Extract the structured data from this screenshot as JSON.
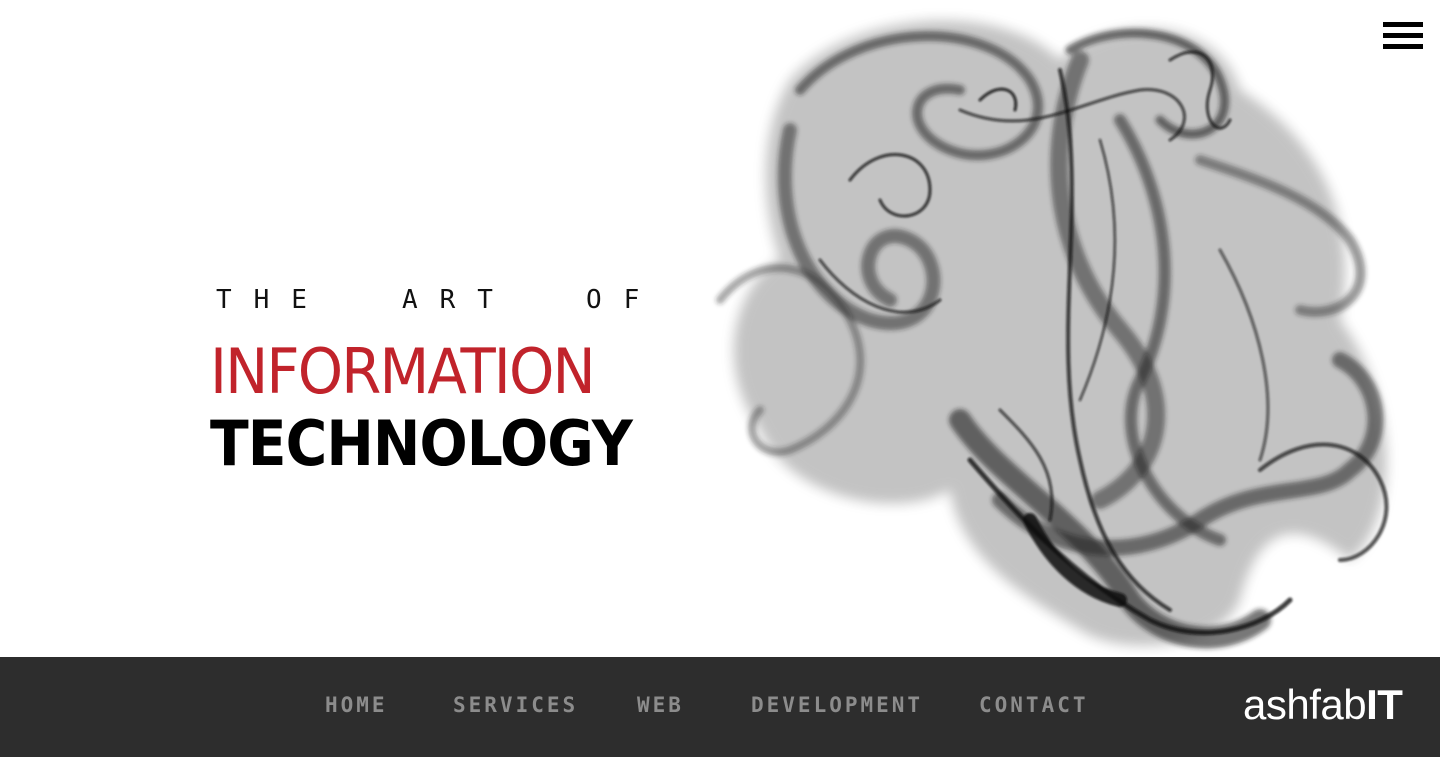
{
  "menu": {
    "icon": "hamburger-menu-icon"
  },
  "hero": {
    "tagline_words": [
      "THE",
      "ART",
      "OF"
    ],
    "headline_line1": "INFORMATION",
    "headline_line2": "TECHNOLOGY",
    "accent_color": "#c1232b"
  },
  "nav": {
    "items": [
      {
        "label": "HOME"
      },
      {
        "label": "SERVICES"
      },
      {
        "label": "WEB"
      },
      {
        "label": "DEVELOPMENT"
      },
      {
        "label": "CONTACT"
      }
    ],
    "background": "#2d2d2d",
    "text_color": "#8c8c8c"
  },
  "logo": {
    "light_part": "ashfab",
    "bold_part": "IT"
  }
}
